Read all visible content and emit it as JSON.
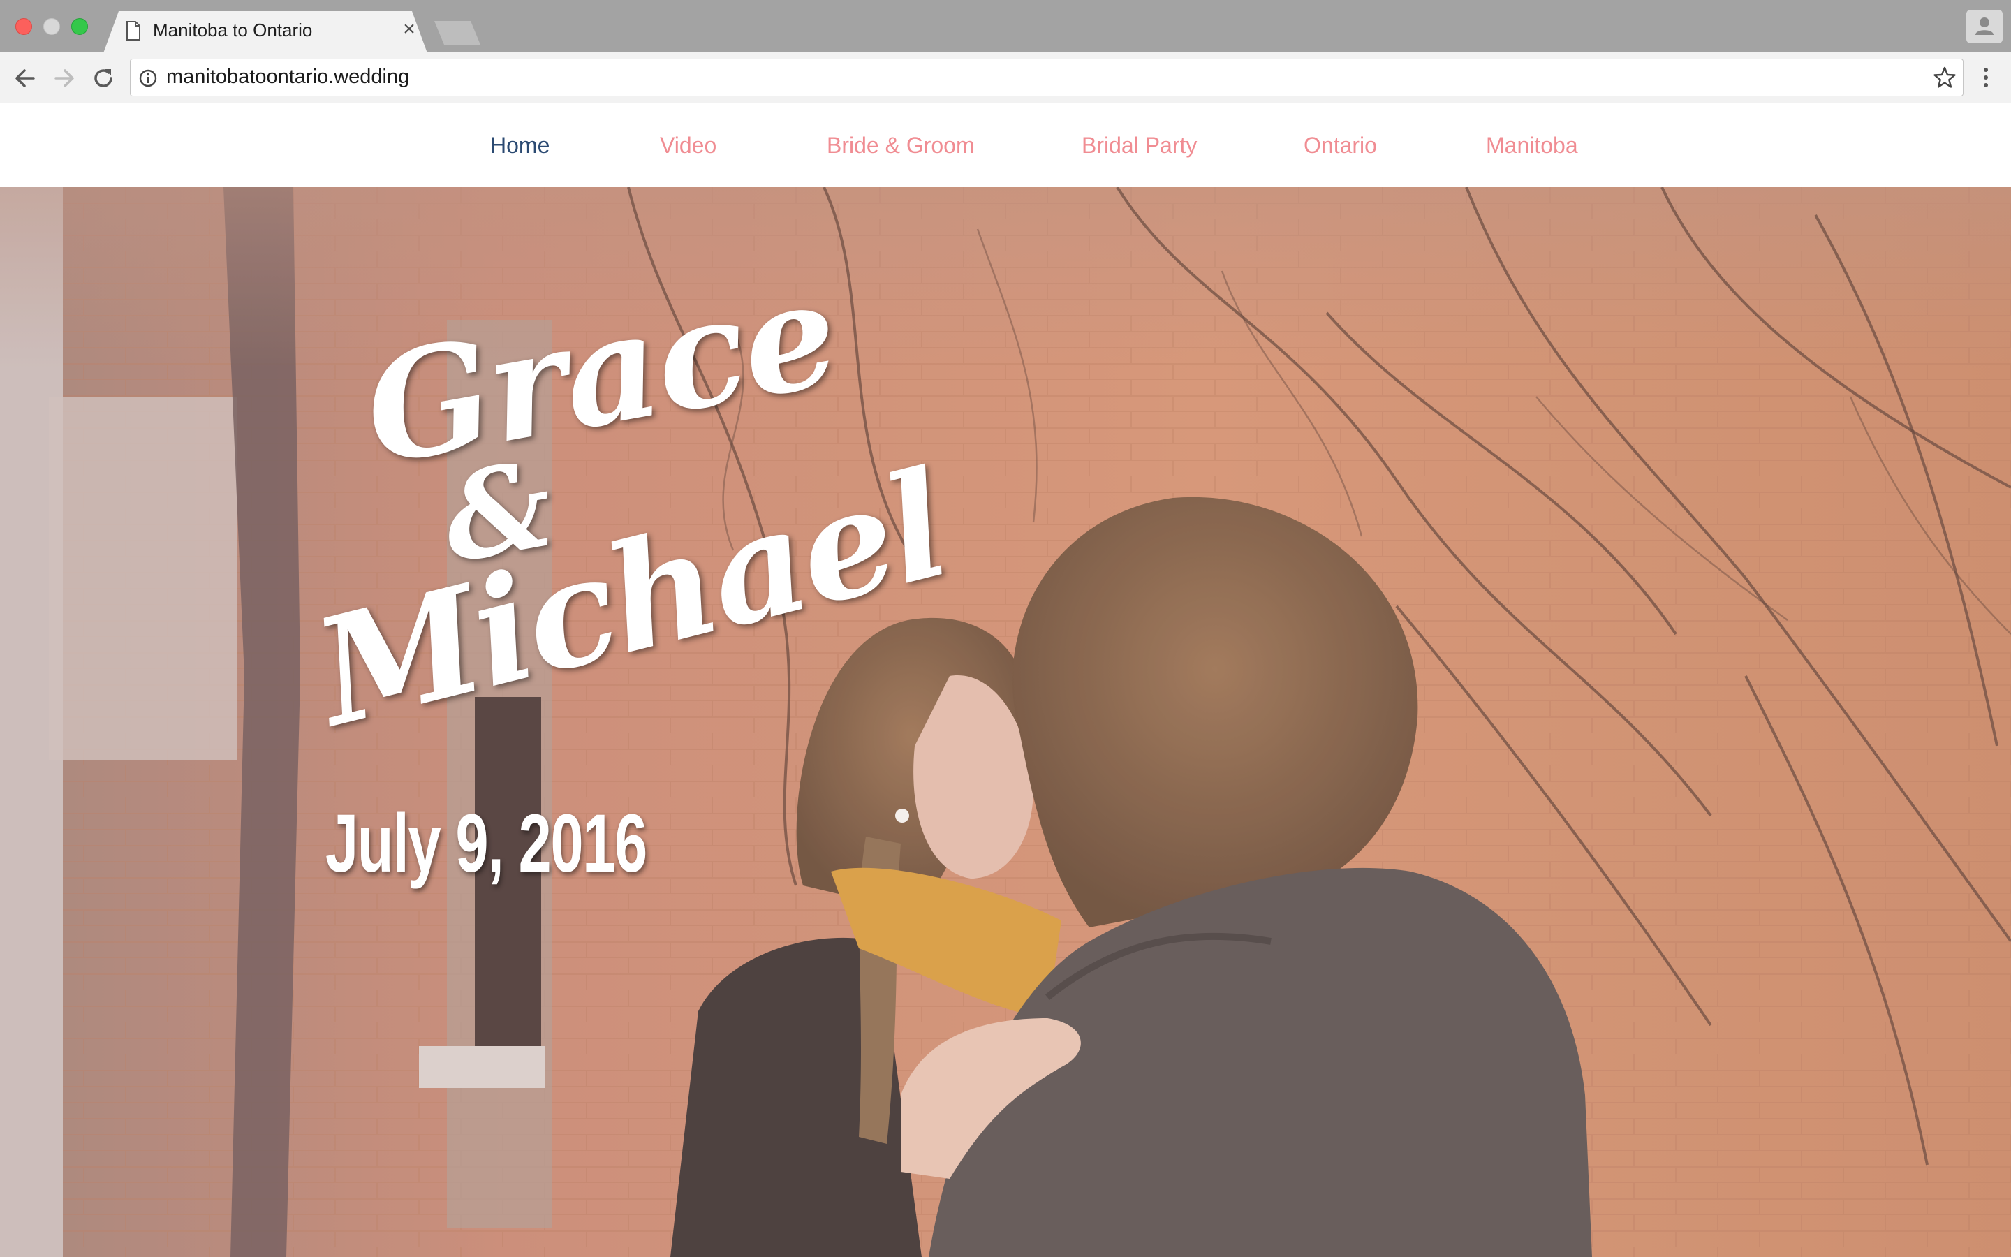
{
  "browser": {
    "tab_title": "Manitoba to Ontario",
    "tab_close": "×",
    "url": "manitobatoontario.wedding",
    "icons": [
      "document-icon",
      "close-icon",
      "back-icon",
      "forward-icon",
      "reload-icon",
      "info-icon",
      "star-icon",
      "menu-icon",
      "profile-icon"
    ]
  },
  "nav": {
    "items": [
      {
        "label": "Home",
        "active": true
      },
      {
        "label": "Video",
        "active": false
      },
      {
        "label": "Bride & Groom",
        "active": false
      },
      {
        "label": "Bridal Party",
        "active": false
      },
      {
        "label": "Ontario",
        "active": false
      },
      {
        "label": "Manitoba",
        "active": false
      }
    ],
    "active_color": "#2b4a72",
    "link_color": "#f08c92"
  },
  "hero": {
    "name_first": "Grace",
    "ampersand": "&",
    "name_second": "Michael",
    "date": "July 9, 2016"
  }
}
